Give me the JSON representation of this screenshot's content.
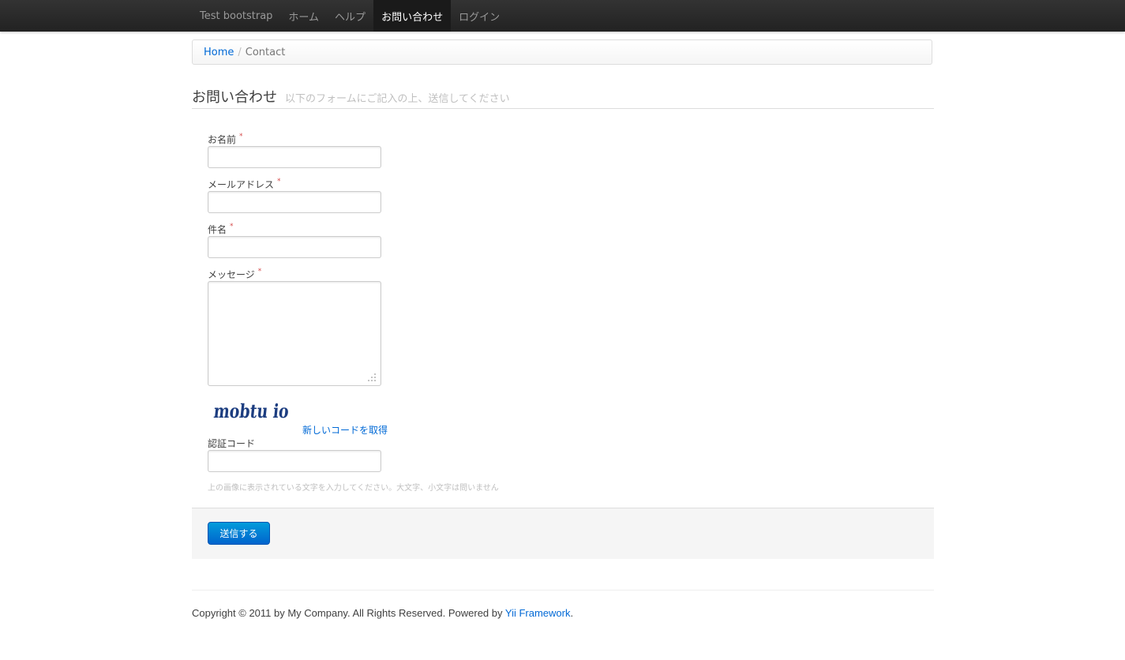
{
  "navbar": {
    "brand": "Test bootstrap",
    "items": [
      {
        "label": "ホーム"
      },
      {
        "label": "ヘルプ"
      },
      {
        "label": "お問い合わせ",
        "active": true
      },
      {
        "label": "ログイン"
      }
    ]
  },
  "breadcrumb": {
    "home": "Home",
    "separator": "/",
    "current": "Contact"
  },
  "header": {
    "title": "お問い合わせ",
    "subtitle": "以下のフォームにご記入の上、送信してください"
  },
  "form": {
    "required_marker": "*",
    "fields": {
      "name": {
        "label": "お名前",
        "value": ""
      },
      "email": {
        "label": "メールアドレス",
        "value": ""
      },
      "subject": {
        "label": "件名",
        "value": ""
      },
      "body": {
        "label": "メッセージ",
        "value": ""
      }
    },
    "captcha": {
      "image_text": "mobtu io",
      "refresh_label": "新しいコードを取得",
      "label": "認証コード",
      "value": "",
      "help": "上の画像に表示されている文字を入力してください。大文字、小文字は問いません"
    },
    "submit_label": "送信する"
  },
  "footer": {
    "text": "Copyright © 2011 by My Company. All Rights Reserved. Powered by ",
    "link": "Yii Framework",
    "suffix": "."
  },
  "colors": {
    "navbar": "#222222",
    "link": "#0069d6",
    "primary_button": "#0064cd",
    "required": "#d54c4c"
  }
}
